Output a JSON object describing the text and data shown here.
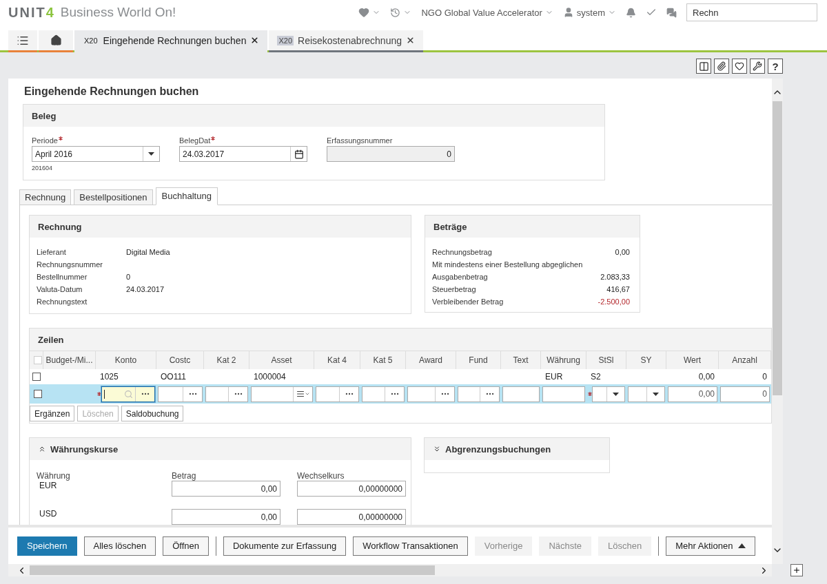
{
  "header": {
    "logo_main": "UNIT",
    "logo_accent": "4",
    "product": "Business World On!",
    "menus": [
      {
        "kind": "favorites"
      },
      {
        "kind": "history"
      },
      {
        "kind": "company",
        "label": "NGO Global Value Accelerator"
      },
      {
        "kind": "user",
        "label": "system"
      }
    ],
    "icons": [
      {
        "kind": "bell"
      },
      {
        "kind": "tasks"
      },
      {
        "kind": "messages"
      }
    ],
    "search": {
      "value": "Rechn"
    }
  },
  "tab_bar": {
    "tabs": [
      {
        "code": "X20",
        "label": "Eingehende Rechnungen buchen",
        "selected": true
      },
      {
        "code": "X20",
        "label": "Reisekostenabrechnung",
        "selected": false
      }
    ]
  },
  "toolbar": {
    "icons": [
      {
        "kind": "layout"
      },
      {
        "kind": "attach"
      },
      {
        "kind": "favorite"
      },
      {
        "kind": "tools"
      }
    ],
    "help": "?"
  },
  "page_title": "Eingehende Rechnungen buchen",
  "beleg": {
    "title": "Beleg",
    "fields": [
      {
        "kind": "select",
        "label": "Periode",
        "required": true,
        "value": "April 2016",
        "hint": "201604"
      },
      {
        "kind": "date",
        "label": "BelegDat",
        "required": true,
        "value": "24.03.2017"
      },
      {
        "kind": "readonly",
        "label": "Erfassungsnummer",
        "required": false,
        "value": "0"
      }
    ]
  },
  "subtabs": [
    {
      "label": "Rechnung",
      "selected": false
    },
    {
      "label": "Bestellpositionen",
      "selected": false
    },
    {
      "label": "Buchhaltung",
      "selected": true
    }
  ],
  "rechnung": {
    "title": "Rechnung",
    "rows": [
      {
        "label": "Lieferant",
        "value": "Digital Media"
      },
      {
        "label": "Rechnungsnummer"
      },
      {
        "label": "Bestellnummer",
        "value": "0"
      },
      {
        "label": "Valuta-Datum",
        "value": "24.03.2017"
      },
      {
        "label": "Rechnungstext"
      }
    ]
  },
  "betraege": {
    "title": "Beträge",
    "rows": [
      {
        "label": "Rechnungsbetrag",
        "value": "0,00"
      },
      {
        "label": "Mit mindestens einer Bestellung abgeglichen"
      },
      {
        "label": "Ausgabenbetrag",
        "value": "2.083,33"
      },
      {
        "label": "Steuerbetrag",
        "value": "416,67"
      },
      {
        "label": "Verbleibender Betrag",
        "value": "-2.500,00",
        "color": "#b3262b"
      }
    ]
  },
  "zeilen": {
    "title": "Zeilen",
    "all_checked": false,
    "columns": [
      "Budget-/Mi...",
      "Konto",
      "Costc",
      "Kat 2",
      "Asset",
      "Kat 4",
      "Kat 5",
      "Award",
      "Fund",
      "Text",
      "Währung",
      "StSl",
      "SY",
      "Wert",
      "Anzahl"
    ],
    "rows": [
      {
        "checked": false,
        "cells": [
          null,
          "1025",
          "OO111",
          null,
          "1000004",
          null,
          null,
          null,
          null,
          null,
          "EUR",
          "S2",
          null,
          "0,00",
          "0"
        ]
      }
    ],
    "edit_row": {
      "checked": false,
      "selected": true,
      "cells": [
        {
          "kind": "none",
          "required": false,
          "focused": false
        },
        {
          "kind": "lookup",
          "required": true,
          "focused": true
        },
        {
          "kind": "ellipsis",
          "required": false,
          "focused": false
        },
        {
          "kind": "ellipsis",
          "required": false,
          "focused": false
        },
        {
          "kind": "list",
          "required": false,
          "focused": false
        },
        {
          "kind": "ellipsis",
          "required": false,
          "focused": false
        },
        {
          "kind": "ellipsis",
          "required": false,
          "focused": false
        },
        {
          "kind": "ellipsis",
          "required": false,
          "focused": false
        },
        {
          "kind": "ellipsis",
          "required": false,
          "focused": false
        },
        {
          "kind": "text",
          "required": false,
          "focused": false
        },
        {
          "kind": "text",
          "required": false,
          "focused": false
        },
        {
          "kind": "dropdown",
          "required": true,
          "focused": false
        },
        {
          "kind": "dropdown",
          "required": false,
          "focused": false
        },
        {
          "kind": "number",
          "required": false,
          "focused": false,
          "value": "0,00"
        },
        {
          "kind": "number",
          "required": false,
          "focused": false,
          "value": "0"
        }
      ]
    },
    "buttons": [
      {
        "label": "Ergänzen",
        "disabled": false
      },
      {
        "label": "Löschen",
        "disabled": true
      },
      {
        "label": "Saldobuchung",
        "disabled": false
      }
    ]
  },
  "currency_rates": {
    "title": "Währungskurse",
    "expanded": true,
    "columns": [
      "Währung",
      "Betrag",
      "Wechselkurs"
    ],
    "rows": [
      {
        "currency": "EUR",
        "amount": "0,00",
        "rate": "0,00000000"
      },
      {
        "currency": "USD",
        "amount": "0,00",
        "rate": "0,00000000"
      }
    ]
  },
  "accruals": {
    "title": "Abgrenzungsbuchungen",
    "expanded": false
  },
  "footer": {
    "groups": [
      [
        {
          "label": "Speichern",
          "kind": "primary",
          "disabled": false
        },
        {
          "label": "Alles löschen",
          "kind": "normal",
          "disabled": false
        },
        {
          "label": "Öffnen",
          "kind": "normal",
          "disabled": false
        }
      ],
      [
        {
          "label": "Dokumente zur Erfassung",
          "kind": "normal",
          "disabled": false
        },
        {
          "label": "Workflow Transaktionen",
          "kind": "normal",
          "disabled": false
        },
        {
          "label": "Vorherige",
          "kind": "normal",
          "disabled": true
        },
        {
          "label": "Nächste",
          "kind": "normal",
          "disabled": true
        },
        {
          "label": "Löschen",
          "kind": "normal",
          "disabled": true
        }
      ],
      [
        {
          "label": "Mehr Aktionen",
          "kind": "menu",
          "disabled": false
        }
      ]
    ]
  }
}
